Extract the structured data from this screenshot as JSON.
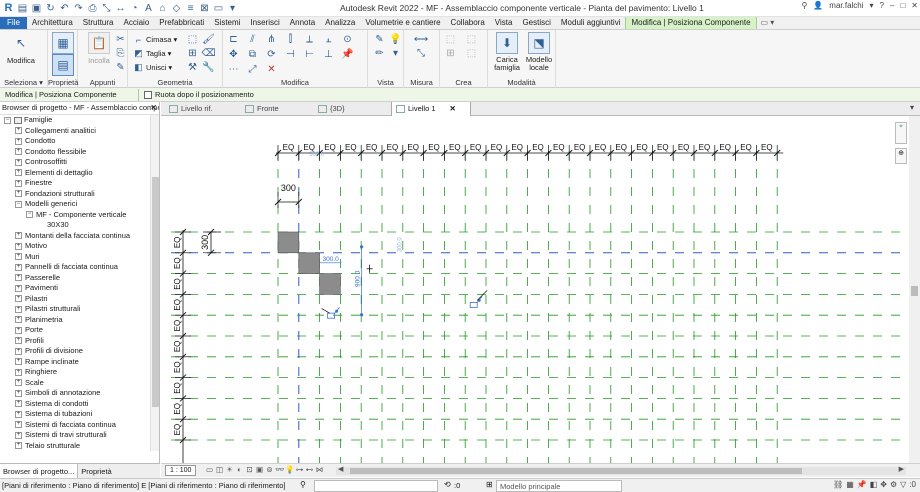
{
  "window": {
    "title": "Autodesk Revit 2022 - MF - Assemblaccio componente verticale - Pianta del pavimento: Livello 1",
    "user": "mar.falchi",
    "logo": "R"
  },
  "quick_access": [
    "open-icon",
    "save-icon",
    "sync-icon",
    "undo-icon",
    "redo-icon",
    "print-icon",
    "measure-icon",
    "dimension-icon",
    "tag-icon",
    "text-icon",
    "3d-icon",
    "section-icon",
    "thin-lines-icon",
    "close-hidden-icon",
    "switch-windows-icon",
    "dropdown-icon"
  ],
  "ribbon_tabs": [
    "File",
    "Architettura",
    "Struttura",
    "Acciaio",
    "Prefabbricati",
    "Sistemi",
    "Inserisci",
    "Annota",
    "Analizza",
    "Volumetrie e cantiere",
    "Collabora",
    "Vista",
    "Gestisci",
    "Moduli aggiuntivi",
    "Modifica | Posiziona Componente"
  ],
  "ribbon": {
    "modify_label": "Modifica",
    "paste_label": "Incolla",
    "cope_label": "Cimasa",
    "cut_label": "Taglia",
    "join_label": "Unisci",
    "load_family_label": "Carica famiglia",
    "in_place_label": "Modello locale",
    "panels": {
      "select": "Seleziona",
      "properties": "Proprietà",
      "clipboard": "Appunti",
      "geometry": "Geometria",
      "modify": "Modifica",
      "view": "Vista",
      "measure": "Misura",
      "create": "Crea",
      "mode": "Modalità"
    }
  },
  "options_bar": {
    "context": "Modifica | Posiziona Componente",
    "rotate_label": "Ruota dopo il posizionamento",
    "rotate_checked": false
  },
  "project_browser": {
    "header": "Browser di progetto - MF - Assemblaccio componente verticale",
    "root": "Famiglie",
    "items": [
      {
        "label": "Collegamenti analitici",
        "level": 1,
        "toggle": "+"
      },
      {
        "label": "Condotto",
        "level": 1,
        "toggle": "+"
      },
      {
        "label": "Condotto flessibile",
        "level": 1,
        "toggle": "+"
      },
      {
        "label": "Controsoffitti",
        "level": 1,
        "toggle": "+"
      },
      {
        "label": "Elementi di dettaglio",
        "level": 1,
        "toggle": "+"
      },
      {
        "label": "Finestre",
        "level": 1,
        "toggle": "+"
      },
      {
        "label": "Fondazioni strutturali",
        "level": 1,
        "toggle": "+"
      },
      {
        "label": "Modelli generici",
        "level": 1,
        "toggle": "-"
      },
      {
        "label": "MF - Componente verticale",
        "level": 2,
        "toggle": "-"
      },
      {
        "label": "30X30",
        "level": 3,
        "toggle": ""
      },
      {
        "label": "Montanti della facciata continua",
        "level": 1,
        "toggle": "+"
      },
      {
        "label": "Motivo",
        "level": 1,
        "toggle": "+"
      },
      {
        "label": "Muri",
        "level": 1,
        "toggle": "+"
      },
      {
        "label": "Pannelli di facciata continua",
        "level": 1,
        "toggle": "+"
      },
      {
        "label": "Passerelle",
        "level": 1,
        "toggle": "+"
      },
      {
        "label": "Pavimenti",
        "level": 1,
        "toggle": "+"
      },
      {
        "label": "Pilastri",
        "level": 1,
        "toggle": "+"
      },
      {
        "label": "Pilastri strutturali",
        "level": 1,
        "toggle": "+"
      },
      {
        "label": "Planimetria",
        "level": 1,
        "toggle": "+"
      },
      {
        "label": "Porte",
        "level": 1,
        "toggle": "+"
      },
      {
        "label": "Profili",
        "level": 1,
        "toggle": "+"
      },
      {
        "label": "Profili di divisione",
        "level": 1,
        "toggle": "+"
      },
      {
        "label": "Rampe inclinate",
        "level": 1,
        "toggle": "+"
      },
      {
        "label": "Ringhiere",
        "level": 1,
        "toggle": "+"
      },
      {
        "label": "Scale",
        "level": 1,
        "toggle": "+"
      },
      {
        "label": "Simboli di annotazione",
        "level": 1,
        "toggle": "+"
      },
      {
        "label": "Sistema di condotti",
        "level": 1,
        "toggle": "+"
      },
      {
        "label": "Sistema di tubazioni",
        "level": 1,
        "toggle": "+"
      },
      {
        "label": "Sistemi di facciata continua",
        "level": 1,
        "toggle": "+"
      },
      {
        "label": "Sistemi di travi strutturali",
        "level": 1,
        "toggle": "+"
      },
      {
        "label": "Telaio strutturale",
        "level": 1,
        "toggle": "+"
      }
    ],
    "bottom_tabs": [
      "Browser di progetto...",
      "Proprietà"
    ]
  },
  "view_tabs": [
    {
      "label": "Livello rif.",
      "active": false
    },
    {
      "label": "Fronte",
      "active": false
    },
    {
      "label": "{3D}",
      "active": false
    },
    {
      "label": "Livello 1",
      "active": true
    }
  ],
  "canvas": {
    "eq_label": "EQ",
    "eq_columns": 24,
    "eq_rows": 10,
    "dim_top": "300",
    "dim_side": "300",
    "temp_dim_h": "300.0",
    "temp_dim_v": "900.0",
    "temp_dim_top": "300.0",
    "temp_dim_side": "300.0",
    "reference_line_color": "#2f5fbf",
    "grid_line_color": "#1f9a1f",
    "component_color": "#8c8c8c"
  },
  "view_control": {
    "scale": "1 : 100"
  },
  "status_bar": {
    "message": "[Piani di riferimento : Piano di riferimento] E [Piani di riferimento : Piano di riferimento]",
    "workset_value": "",
    "zero_label": ":0",
    "model_label": "Modello principale",
    "filter_count": ":0"
  }
}
